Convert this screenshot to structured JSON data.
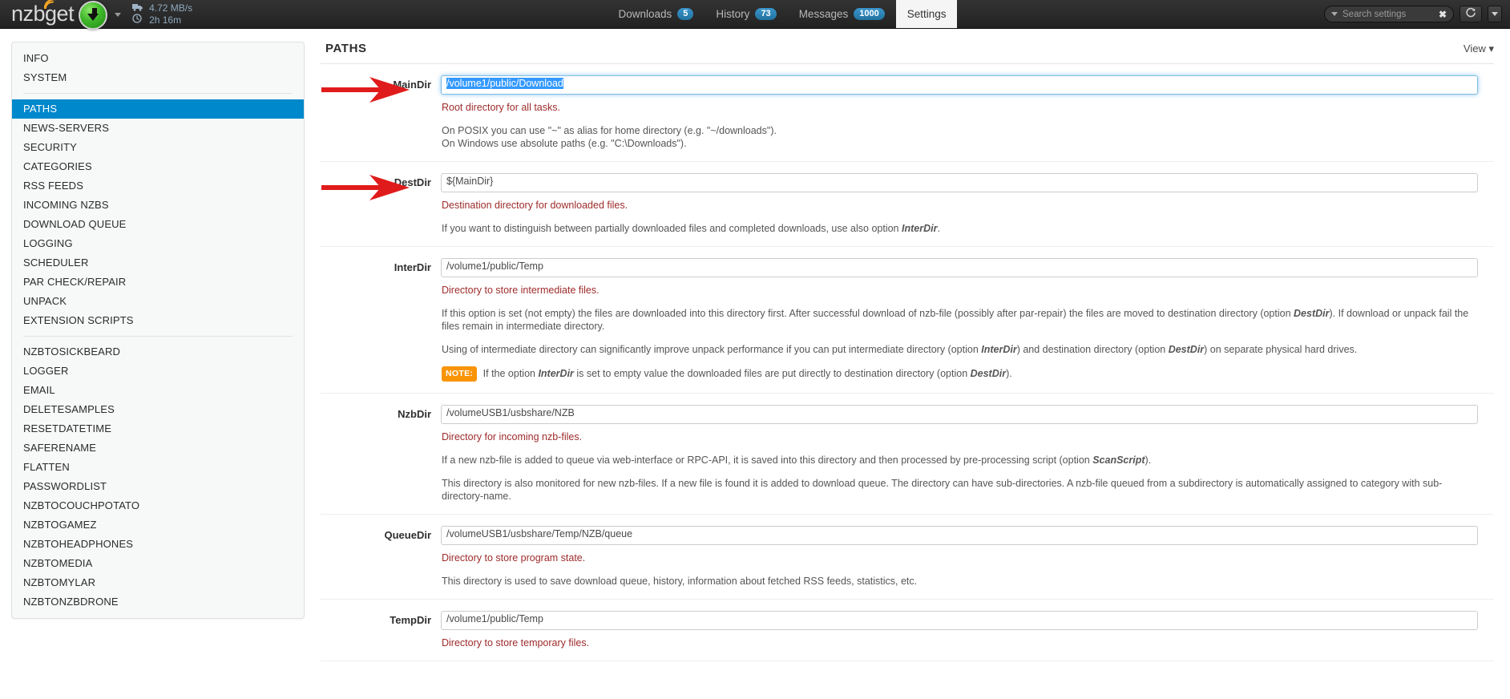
{
  "navbar": {
    "brand": "nzbget",
    "brand_wifi_icon": "wifi-icon",
    "logo_icon": "download-circle-icon",
    "brand_caret_icon": "chevron-down-icon",
    "speed_icon": "truck-icon",
    "speed": "4.72 MB/s",
    "time_icon": "clock-icon",
    "time_remaining": "2h 16m",
    "tabs": [
      {
        "label": "Downloads",
        "badge": "5",
        "active": false
      },
      {
        "label": "History",
        "badge": "73",
        "active": false
      },
      {
        "label": "Messages",
        "badge": "1000",
        "active": false
      },
      {
        "label": "Settings",
        "badge": "",
        "active": true
      }
    ],
    "search": {
      "placeholder": "Search settings",
      "caret_icon": "chevron-down-icon",
      "clear_icon": "close-icon"
    },
    "refresh_icon": "refresh-icon",
    "refresh_caret_icon": "chevron-down-icon"
  },
  "sidebar": {
    "groups": [
      {
        "items": [
          {
            "label": "INFO",
            "active": false
          },
          {
            "label": "SYSTEM",
            "active": false
          }
        ]
      },
      {
        "items": [
          {
            "label": "PATHS",
            "active": true
          },
          {
            "label": "NEWS-SERVERS",
            "active": false
          },
          {
            "label": "SECURITY",
            "active": false
          },
          {
            "label": "CATEGORIES",
            "active": false
          },
          {
            "label": "RSS FEEDS",
            "active": false
          },
          {
            "label": "INCOMING NZBS",
            "active": false
          },
          {
            "label": "DOWNLOAD QUEUE",
            "active": false
          },
          {
            "label": "LOGGING",
            "active": false
          },
          {
            "label": "SCHEDULER",
            "active": false
          },
          {
            "label": "PAR CHECK/REPAIR",
            "active": false
          },
          {
            "label": "UNPACK",
            "active": false
          },
          {
            "label": "EXTENSION SCRIPTS",
            "active": false
          }
        ]
      },
      {
        "items": [
          {
            "label": "NZBTOSICKBEARD",
            "active": false
          },
          {
            "label": "LOGGER",
            "active": false
          },
          {
            "label": "EMAIL",
            "active": false
          },
          {
            "label": "DELETESAMPLES",
            "active": false
          },
          {
            "label": "RESETDATETIME",
            "active": false
          },
          {
            "label": "SAFERENAME",
            "active": false
          },
          {
            "label": "FLATTEN",
            "active": false
          },
          {
            "label": "PASSWORDLIST",
            "active": false
          },
          {
            "label": "NZBTOCOUCHPOTATO",
            "active": false
          },
          {
            "label": "NZBTOGAMEZ",
            "active": false
          },
          {
            "label": "NZBTOHEADPHONES",
            "active": false
          },
          {
            "label": "NZBTOMEDIA",
            "active": false
          },
          {
            "label": "NZBTOMYLAR",
            "active": false
          },
          {
            "label": "NZBTONZBDRONE",
            "active": false
          }
        ]
      }
    ]
  },
  "main": {
    "title": "PATHS",
    "view_label": "View",
    "view_caret_icon": "chevron-down-icon",
    "options": [
      {
        "label": "MainDir",
        "value": "/volume1/public/Download",
        "focused": true,
        "selected": true,
        "annotated": true,
        "desc": "Root directory for all tasks.",
        "notes": [
          "On POSIX you can use \"~\" as alias for home directory (e.g. \"~/downloads\").<br>On Windows use absolute paths (e.g. \"C:\\Downloads\")."
        ]
      },
      {
        "label": "DestDir",
        "value": "${MainDir}",
        "focused": false,
        "selected": false,
        "annotated": true,
        "desc": "Destination directory for downloaded files.",
        "notes": [
          "If you want to distinguish between partially downloaded files and completed downloads, use also option <i>InterDir</i>."
        ]
      },
      {
        "label": "InterDir",
        "value": "/volume1/public/Temp",
        "focused": false,
        "selected": false,
        "annotated": false,
        "desc": "Directory to store intermediate files.",
        "notes": [
          "If this option is set (not empty) the files are downloaded into this directory first. After successful download of nzb-file (possibly after par-repair) the files are moved to destination directory (option <i>DestDir</i>). If download or unpack fail the files remain in intermediate directory.",
          "Using of intermediate directory can significantly improve unpack performance if you can put intermediate directory (option <i>InterDir</i>) and destination directory (option <i>DestDir</i>) on separate physical hard drives.",
          "<span class=\"note-badge\">NOTE:</span> If the option <i>InterDir</i> is set to empty value the downloaded files are put directly to destination directory (option <i>DestDir</i>)."
        ]
      },
      {
        "label": "NzbDir",
        "value": "/volumeUSB1/usbshare/NZB",
        "focused": false,
        "selected": false,
        "annotated": false,
        "desc": "Directory for incoming nzb-files.",
        "notes": [
          "If a new nzb-file is added to queue via web-interface or RPC-API, it is saved into this directory and then processed by pre-processing script (option <i>ScanScript</i>).",
          "This directory is also monitored for new nzb-files. If a new file is found it is added to download queue. The directory can have sub-directories. A nzb-file queued from a subdirectory is automatically assigned to category with sub-directory-name."
        ]
      },
      {
        "label": "QueueDir",
        "value": "/volumeUSB1/usbshare/Temp/NZB/queue",
        "focused": false,
        "selected": false,
        "annotated": false,
        "desc": "Directory to store program state.",
        "notes": [
          "This directory is used to save download queue, history, information about fetched RSS feeds, statistics, etc."
        ]
      },
      {
        "label": "TempDir",
        "value": "/volume1/public/Temp",
        "focused": false,
        "selected": false,
        "annotated": false,
        "desc": "Directory to store temporary files.",
        "notes": []
      }
    ]
  },
  "colors": {
    "accent": "#0088cc",
    "desc_red": "#9e2b2b",
    "note_orange": "#f89406",
    "annotation_red": "#e01b1b",
    "navbar_bg": "#2b2b2b"
  }
}
